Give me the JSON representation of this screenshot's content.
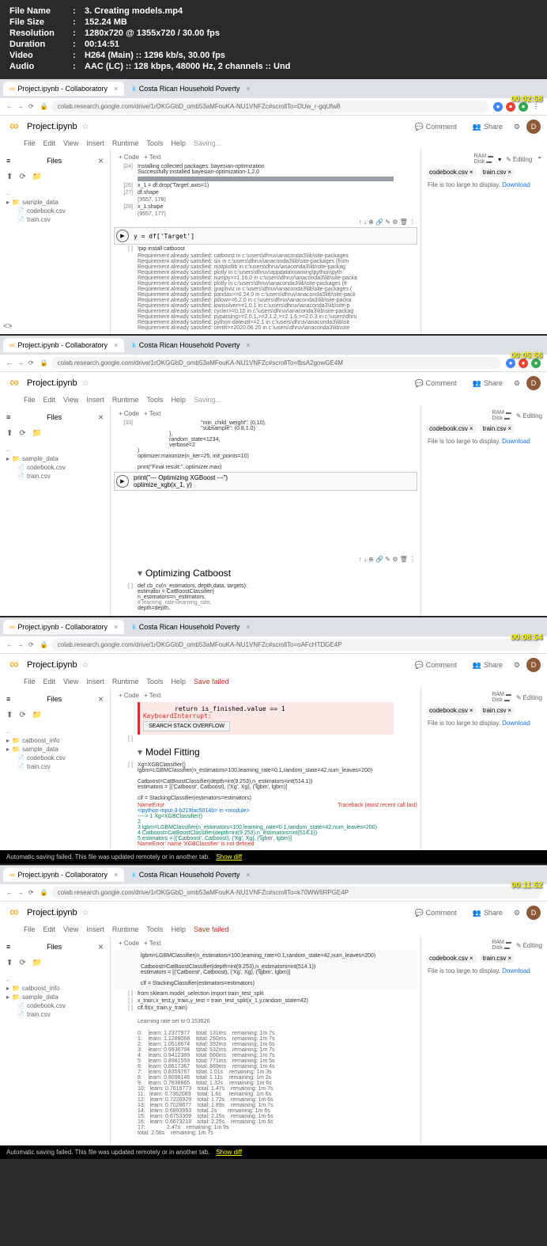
{
  "header": {
    "filename_label": "File Name",
    "filename": "3. Creating models.mp4",
    "filesize_label": "File Size",
    "filesize": "152.24 MB",
    "resolution_label": "Resolution",
    "resolution": "1280x720 @ 1355x720 / 30.00 fps",
    "duration_label": "Duration",
    "duration": "00:14:51",
    "video_label": "Video",
    "video": "H264 (Main) :: 1296 kb/s, 30.00 fps",
    "audio_label": "Audio",
    "audio": "AAC (LC) :: 128 kbps, 48000 Hz, 2 channels :: Und"
  },
  "tabs": {
    "tab1": "Project.ipynb - Collaboratory",
    "tab2": "Costa Rican Household Poverty"
  },
  "urls": {
    "url1": "colab.research.google.com/drive/1rOKGGbD_omb53aMFouKA-NU1VNFZc#scrollTo=DUw_r-gqUfw8",
    "url2": "colab.research.google.com/drive/1rOKGGbD_omb53aMFouKA-NU1VNFZc#scrollTo=fbsA2gowGE4M",
    "url3": "colab.research.google.com/drive/1rOKGGbD_omb53aMFouKA-NU1VNFZc#scrollTo=oAFcHTDGE4P",
    "url4": "colab.research.google.com/drive/1rOKGGbD_omb53aMFouKA-NU1VNFZc#scrollTo=k70WW6RPGE4P"
  },
  "timestamps": {
    "t1": "00:02:58",
    "t2": "00:05:56",
    "t3": "00:08:54",
    "t4": "00:11:52"
  },
  "colab": {
    "title": "Project.ipynb",
    "comment": "Comment",
    "share": "Share",
    "avatar": "D",
    "menu": [
      "File",
      "Edit",
      "View",
      "Insert",
      "Runtime",
      "Tools",
      "Help"
    ],
    "saving": "Saving...",
    "save_failed": "Save failed",
    "files": "Files",
    "code_btn": "+ Code",
    "text_btn": "+ Text",
    "ram": "RAM",
    "disk": "Disk",
    "editing": "Editing"
  },
  "sidebar": {
    "dots": "..",
    "items1": [
      "sample_data",
      "codebook.csv",
      "train.csv"
    ],
    "items2": [
      "catboost_info",
      "sample_data",
      "codebook.csv",
      "train.csv"
    ]
  },
  "right": {
    "tab1": "codebook.csv",
    "tab2": "train.csv",
    "msg": "File is too large to display.",
    "download": "Download"
  },
  "shot1": {
    "c24": "Installing collected packages: bayesian-optimization",
    "c24b": "Successfully installed bayesian-optimization-1.2.0",
    "c26_num": "[26]",
    "c26": "x_1 = df.drop('Target',axis=1)",
    "c27_num": "[27]",
    "c27": "df.shape",
    "c27_out": "(9557, 178)",
    "c28_num": "[28]",
    "c28": "x_1.shape",
    "c28_out": "(9557, 177)",
    "active": "y = df['Target']",
    "pip_num": "[ ]",
    "pip": "!pip install catboost",
    "req1": "Requirement already satisfied: catboost in c:\\users\\dhruv\\anaconda3\\lib\\site-packages",
    "req2": "Requirement already satisfied: six in c:\\users\\dhruv\\anaconda3\\lib\\site-packages (from",
    "req3": "Requirement already satisfied: matplotlib in c:\\users\\dhruv\\anaconda3\\lib\\site-packag",
    "req4": "Requirement already satisfied: plotly in c:\\users\\dhruv\\appdata\\roaming\\python\\pyth",
    "req5": "Requirement already satisfied: numpy>=1.16.0 in c:\\users\\dhruv\\anaconda3\\lib\\site-packa",
    "req6": "Requirement already satisfied: plotly in c:\\users\\dhruv\\anaconda3\\lib\\site-packages (fr",
    "req7": "Requirement already satisfied: graphviz in c:\\users\\dhruv\\anaconda3\\lib\\site-packages (",
    "req8": "Requirement already satisfied: pandas>=0.24.0 in c:\\users\\dhruv\\anaconda3\\lib\\site-pack",
    "req9": "Requirement already satisfied: pillow>=6.2.0 in c:\\users\\dhruv\\anaconda3\\lib\\site-packa",
    "req10": "Requirement already satisfied: kiwisolver>=1.0.1 in c:\\users\\dhruv\\anaconda3\\lib\\site-p",
    "req11": "Requirement already satisfied: cycler>=0.10 in c:\\users\\dhruv\\anaconda3\\lib\\site-packag",
    "req12": "Requirement already satisfied: pyparsing>=2.0.1,>=2.1.2,>=2.1.6,>=2.0.3 in c:\\users\\dhru",
    "req13": "Requirement already satisfied: python-dateutil>=2.1 in c:\\users\\dhruv\\anaconda3\\lib\\sit",
    "req14": "Requirement already satisfied: certifi>=2020.06.20 in c:\\users\\dhruv\\anaconda3\\lib\\site"
  },
  "shot2": {
    "c33_num": "[33]",
    "line1": "\"min_child_weight\": (0,10),",
    "line2": "\"subsample\": (0.8,1.0)",
    "line3": "},",
    "line4": "random_state=1234,",
    "line5": "verbose=2",
    "line6": ")",
    "line7": "optimizer.maximize(n_iter=25, init_points=10)",
    "line8": "print(\"Final result:\", optimizer.max)",
    "active1": "print(\"--- Optimizing XGBoost ---\")",
    "active2": "optimize_xgb(x_1, y)",
    "section": "Optimizing Catboost",
    "def_num": "[ ]",
    "def1": "def cb_cv(n_estimators, depth,data, targets):",
    "def2": "    estimator = CatBoostClassifier(",
    "def3": "        n_estimators=n_estimators,",
    "def4": "#       learning_rate=learning_rate,",
    "def5": "        depth=depth,"
  },
  "shot3": {
    "err_line": "return is_finished.value == 1",
    "err_type": "KeyboardInterrupt:",
    "search": "SEARCH STACK OVERFLOW",
    "section": "Model Fitting",
    "c1_num": "[ ]",
    "c1_1": "Xg=XGBClassifier()",
    "c1_2": "lgbm=LGBMClassifier(n_estimators=100,learning_rate=0.1,random_state=42,num_leaves=200)",
    "c1_3": "Catboost=CatBoostClassifier(depth=int(9.253),n_estimators=int(514.1))",
    "c1_4": "estimators = [('Catboost', Catboost), ('Xg', Xg), ('lgbm', lgbm)]",
    "c1_5": "clf = StackingClassifier(estimators=estimators)",
    "err1": "NameError",
    "err1b": "Traceback (most recent call last)",
    "err2": "<ipython-input-3-b219fac5014b> in <module>",
    "err3": "----> 1 Xg=XGBClassifier()",
    "err4": "      2",
    "err5": "      3 lgbm=LGBMClassifier(n_estimators=100,learning_rate=0.1,random_state=42,num_leaves=200)",
    "err6": "      4 Catboost=CatBoostClassifier(depth=int(9.253),n_estimators=int(514.1))",
    "err7": "      5 estimators = [('Catboost', Catboost), ('Xg', Xg), ('lgbm', lgbm)]",
    "err8": "NameError: name 'XGBClassifier' is not defined"
  },
  "shot4": {
    "c1_1": "lgbm=LGBMClassifier(n_estimators=100,learning_rate=0.1,random_state=42,num_leaves=200)",
    "c1_2": "Catboost=CatBoostClassifier(depth=int(9.253),n_estimators=int(514.1))",
    "c1_3": "estimators = [('Catboost', Catboost), ('Xg', Xg), ('lgbm', lgbm)]",
    "c1_4": "clf = StackingClassifier(estimators=estimators)",
    "c2_num": "[ ]",
    "c2": "from sklearn.model_selection import train_test_split",
    "c3_num": "[ ]",
    "c3": "x_train,x_test,y_train,y_test = train_test_split(x_1,y,random_state=42)",
    "c4_num": "[ ]",
    "c4": "clf.fit(x_train,y_train)",
    "out0": "Learning rate set to 0.153526",
    "rows": [
      "0:    learn: 1.2377977    total: 131ms    remaining: 1m 7s",
      "1:    learn: 1.1289068    total: 260ms    remaining: 1m 7s",
      "2:    learn: 1.0518674    total: 392ms    remaining: 1m 6s",
      "3:    learn: 0.9936704    total: 532ms    remaining: 1m 7s",
      "4:    learn: 0.9412389    total: 660ms    remaining: 1m 7s",
      "5:    learn: 0.8981559    total: 771ms    remaining: 1m 5s",
      "6:    learn: 0.8617367    total: 889ms    remaining: 1m 4s",
      "7:    learn: 0.8359767    total: 1.01s    remaining: 1m 3s",
      "8:    learn: 0.8098146    total: 1.11s    remaining: 1m 2s",
      "9:    learn: 0.7838865    total: 1.32s    remaining: 1m 6s",
      "10:   learn: 0.7616773    total: 1.47s    remaining: 1m 7s",
      "11:   learn: 0.7362089    total: 1.6s     remaining: 1m 6s",
      "12:   learn: 0.7226929    total: 1.72s    remaining: 1m 6s",
      "13:   learn: 0.7028677    total: 1.89s    remaining: 1m 7s",
      "14:   learn: 0.6893953    total: 2s       remaining: 1m 6s",
      "15:   learn: 0.6753309    total: 2.15s    remaining: 1m 6s",
      "16:   learn: 0.6673218    total: 2.25s    remaining: 1m 6s",
      "17:              2.47s    remaining: 1m 9s",
      "total: 2.58s    remaining: 1m 7s"
    ]
  },
  "bottom": {
    "msg": "Automatic saving failed. This file was updated remotely or in another tab.",
    "diff": "Show diff"
  }
}
